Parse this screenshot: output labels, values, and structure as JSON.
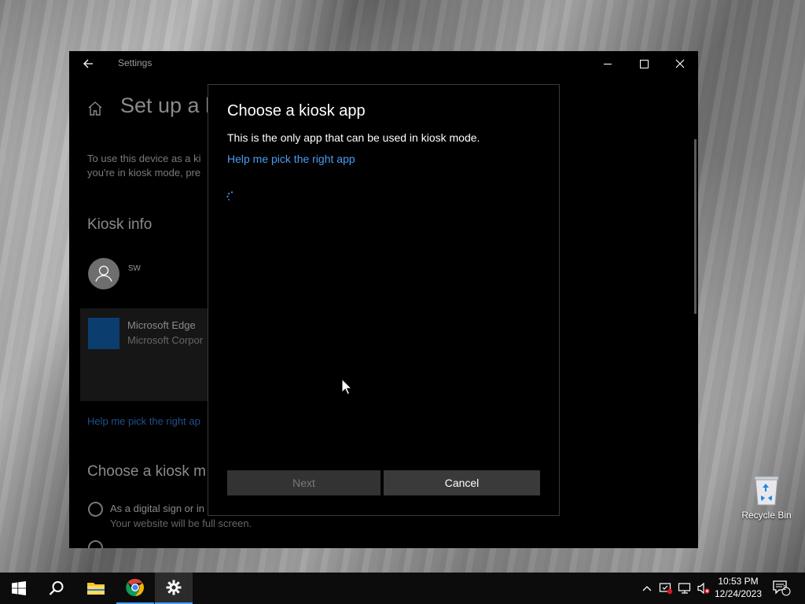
{
  "settings": {
    "window_title": "Settings",
    "page_title": "Set up a k",
    "description_line1": "To use this device as a ki",
    "description_line2": "you're in kiosk mode, pre",
    "kiosk_info_heading": "Kiosk info",
    "user_name": "sw",
    "app_name": "Microsoft Edge",
    "app_publisher": "Microsoft Corpor",
    "help_link": "Help me pick the right ap",
    "choose_mode_heading": "Choose a kiosk m",
    "option1_label": "As a digital sign or in",
    "option1_desc": "Your website will be full screen."
  },
  "dialog": {
    "title": "Choose a kiosk app",
    "subtitle": "This is the only app that can be used in kiosk mode.",
    "help_link": "Help me pick the right app",
    "next_label": "Next",
    "cancel_label": "Cancel"
  },
  "desktop": {
    "recycle_bin_label": "Recycle Bin"
  },
  "taskbar": {
    "time": "10:53 PM",
    "date": "12/24/2023",
    "notification_count": "1",
    "items": [
      "start-icon",
      "search-icon",
      "file-explorer-icon",
      "chrome-icon",
      "settings-icon"
    ]
  },
  "colors": {
    "accent": "#4a9df0",
    "edge_tile": "#0b3e6e"
  }
}
